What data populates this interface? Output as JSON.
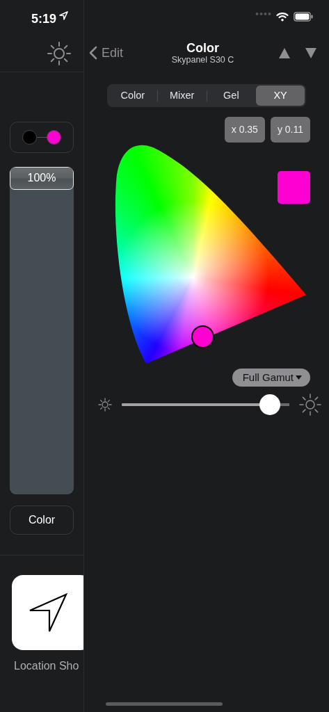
{
  "status_bar": {
    "time": "5:19"
  },
  "sidebar": {
    "range_dots": [
      {
        "color": "#000000"
      },
      {
        "color": "#ff00d2"
      }
    ],
    "fader": {
      "label": "100%",
      "level": 1
    },
    "mode_button": "Color",
    "shortcut": {
      "label": "Location Sho"
    }
  },
  "nav": {
    "back": "Edit",
    "title": "Color",
    "subtitle": "Skypanel S30 C"
  },
  "segments": [
    {
      "label": "Color",
      "selected": false
    },
    {
      "label": "Mixer",
      "selected": false
    },
    {
      "label": "Gel",
      "selected": false
    },
    {
      "label": "XY",
      "selected": true
    }
  ],
  "coordinates": [
    "x 0.35",
    "y 0.11"
  ],
  "swatch": {
    "color": "#ff00d2"
  },
  "gamut_button": "Full Gamut",
  "brightness": {
    "level": 0.94
  }
}
